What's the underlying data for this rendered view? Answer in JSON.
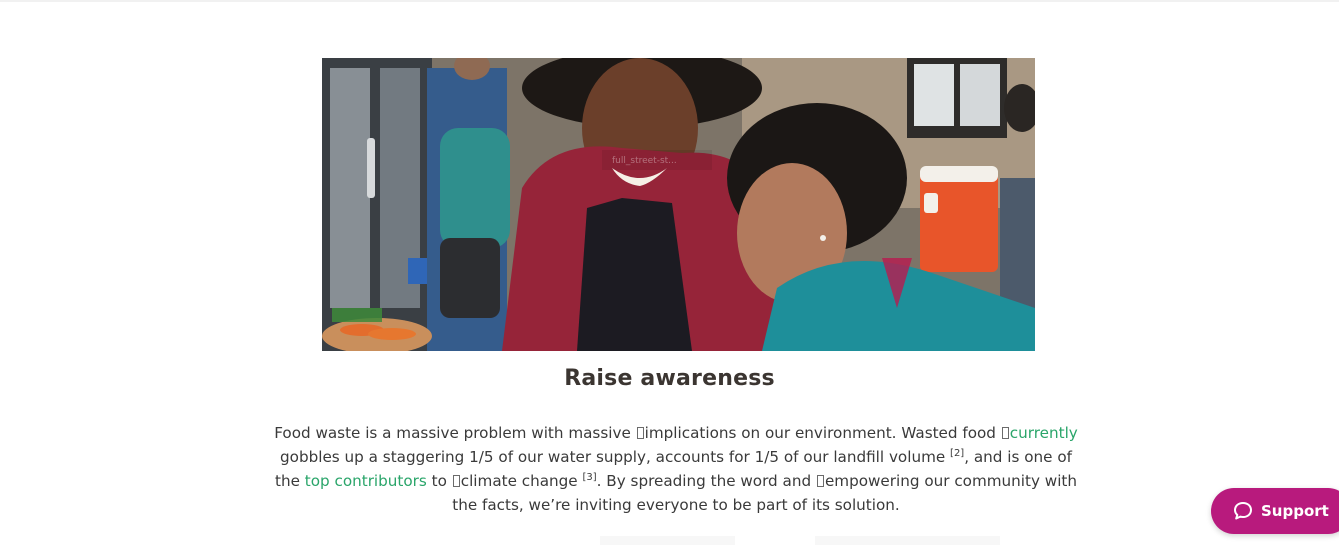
{
  "hero": {
    "image_alt": "Volunteer helping a woman at a food distribution table",
    "overlay_caption": "full_street-st..."
  },
  "section": {
    "title": "Raise awareness",
    "paragraph": {
      "t1": "Food waste is a massive problem with massive ",
      "t2": "implications on our environment. Wasted food ",
      "link1": "currently",
      "t3": " gobbles up a staggering 1/5 of our water supply, accounts for 1/5 of our landfill volume ",
      "ref1": "[2]",
      "t4": ", and is one of the ",
      "link2": "top contributors",
      "t5": " to ",
      "t6": "climate change ",
      "ref2": "[3]",
      "t7": ". By spreading the word and ",
      "t8": "empowering our community with the facts, we’re inviting everyone to be part of its solution."
    }
  },
  "support": {
    "label": "Support",
    "icon": "chat-bubble-icon",
    "color": "#b81a7d"
  },
  "colors": {
    "link": "#2aa56a",
    "heading": "#3b3531",
    "text": "#3a3a3a"
  }
}
